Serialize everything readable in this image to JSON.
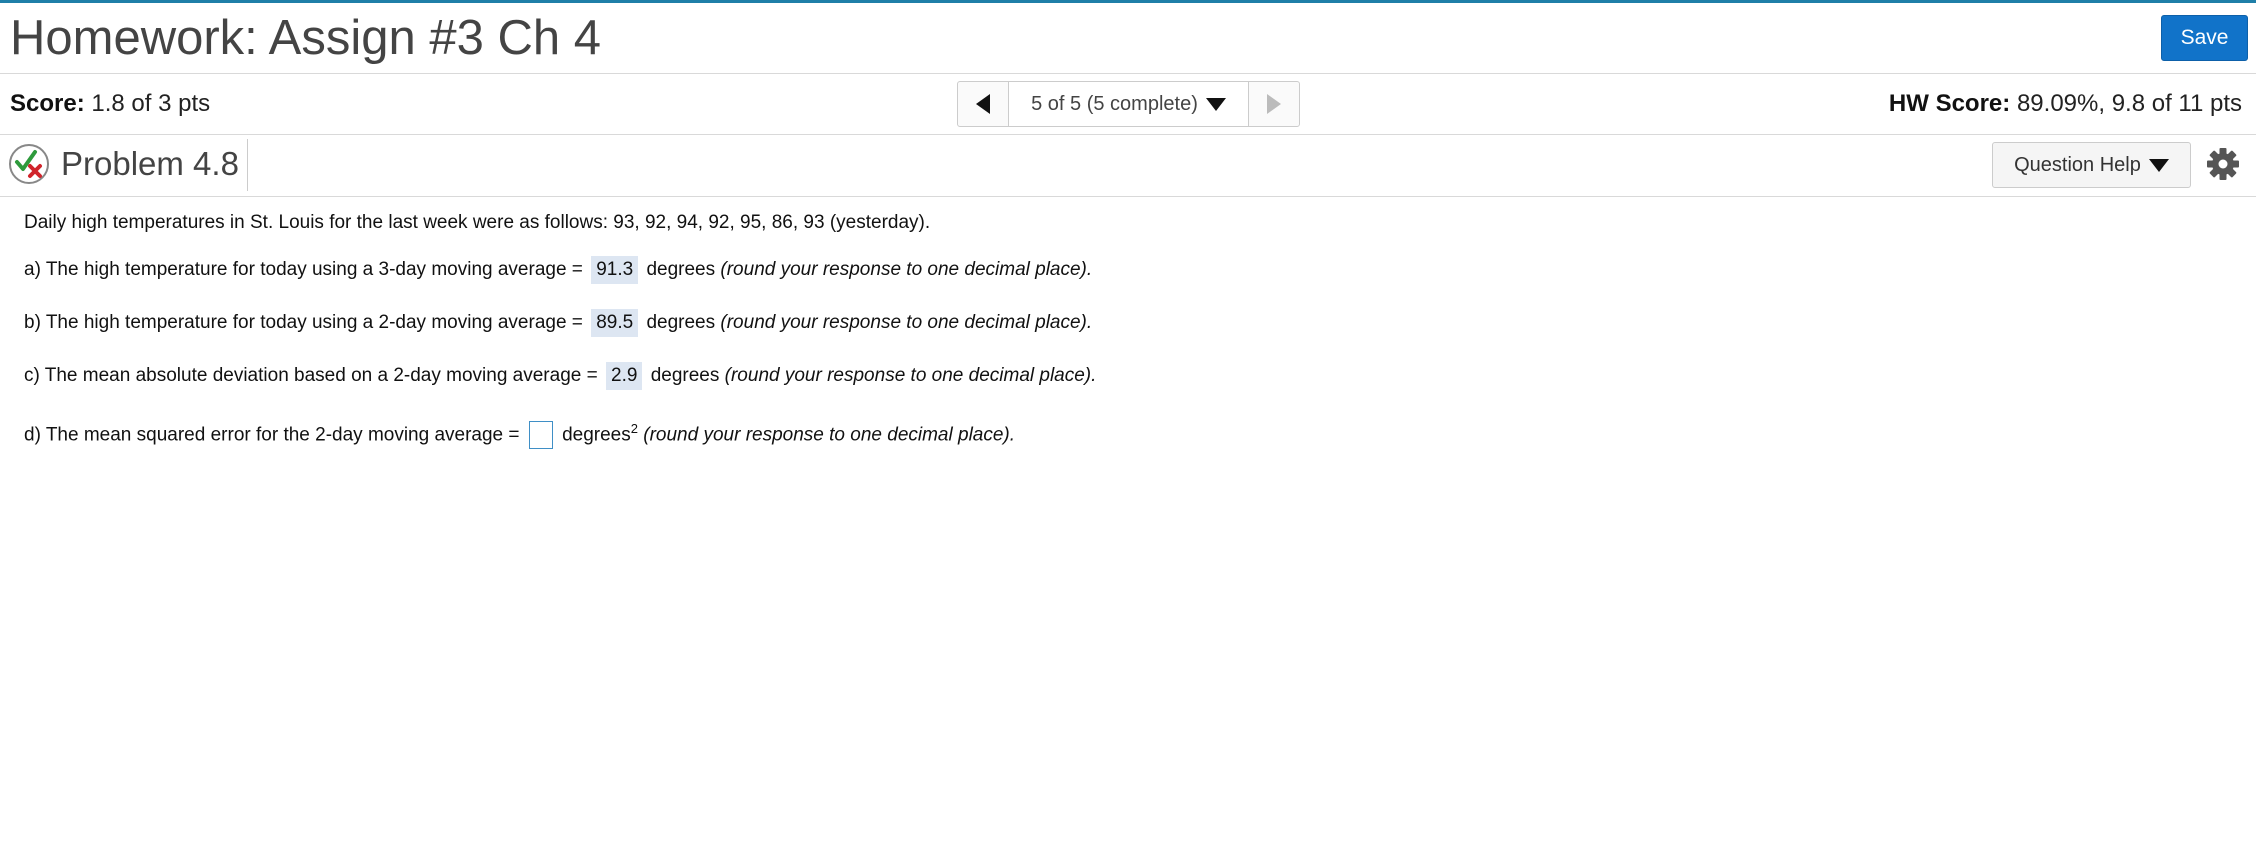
{
  "header": {
    "title": "Homework: Assign #3 Ch 4",
    "save_label": "Save"
  },
  "scorebar": {
    "score_label": "Score:",
    "score_value": "1.8 of 3 pts",
    "nav_status": "5 of 5 (5 complete)",
    "hw_label": "HW Score:",
    "hw_value": "89.09%, 9.8 of 11 pts"
  },
  "problem": {
    "title": "Problem 4.8",
    "help_label": "Question Help",
    "status_icon": "partial-correct-icon",
    "intro": "Daily high temperatures in St. Louis for the last week were as follows: 93, 92, 94, 92, 95, 86, 93 (yesterday).",
    "parts": [
      {
        "prefix": "a) The high temperature for today using a 3-day moving average =",
        "answer": "91.3",
        "unit": "degrees",
        "hint": "(round your response to one decimal place)."
      },
      {
        "prefix": "b) The high temperature for today using a 2-day moving average =",
        "answer": "89.5",
        "unit": "degrees",
        "hint": "(round your response to one decimal place)."
      },
      {
        "prefix": "c) The mean absolute deviation based on a 2-day moving average =",
        "answer": "2.9",
        "unit": "degrees",
        "hint": "(round your response to one decimal place)."
      },
      {
        "prefix": "d) The mean squared error for the 2-day moving average =",
        "answer": "",
        "unit": "degrees",
        "unit_sup": "2",
        "hint": "(round your response to one decimal place)."
      }
    ]
  },
  "icons": {
    "prev": "triangle-left-icon",
    "next": "triangle-right-icon",
    "dropdown": "caret-down-icon",
    "settings": "gear-icon"
  },
  "colors": {
    "accent": "#1173c9",
    "answer_bg": "#dde6f2",
    "top_line": "#1f7fa8"
  }
}
